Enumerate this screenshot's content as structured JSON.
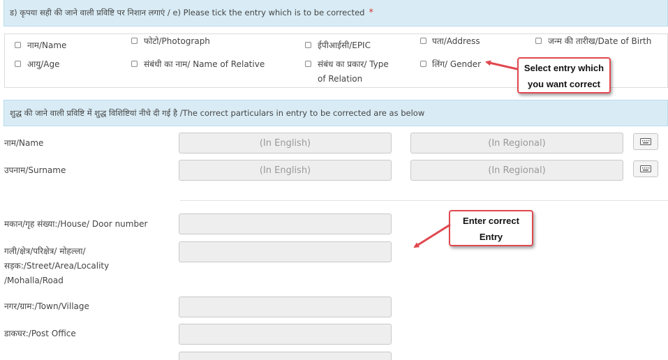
{
  "section_e": {
    "heading": "ड) कृपया सही की जाने वाली प्रविष्टि पर निशान लगाएं / e) Please tick the entry which is to be corrected",
    "required_mark": "*",
    "options": [
      {
        "label": "नाम/Name"
      },
      {
        "label": "फोटो/Photograph"
      },
      {
        "label": "ईपीआईसी/EPIC"
      },
      {
        "label": "पता/Address"
      },
      {
        "label": "जन्म की तारीख/Date of Birth"
      },
      {
        "label": "आयु/Age"
      },
      {
        "label": "संबंधी का नाम/ Name of Relative"
      },
      {
        "label_line1": "संबंध का प्रकार/ Type",
        "label_line2": "of Relation"
      },
      {
        "label": "लिंग/ Gender"
      }
    ]
  },
  "callouts": {
    "select_entry": {
      "line1": "Select entry which",
      "line2": "you want correct"
    },
    "enter_correct": {
      "line1": "Enter correct",
      "line2": "Entry"
    }
  },
  "correct_section": {
    "heading": "शुद्ध की जाने वाली प्रविष्टि में शुद्ध विशिष्टियां नीचे दी गई है /The correct particulars in entry to be corrected are as below",
    "name_label": "नाम/Name",
    "surname_label": "उपनाम/Surname",
    "placeholder_english": "(In English)",
    "placeholder_regional": "(In Regional)",
    "house_label": "मकान/गृह संख्या:/House/ Door number",
    "street_label": [
      "गली/क्षेत्र/परिक्षेत्र/ मोहल्ला/",
      "सड़क:/Street/Area/Locality",
      "/Mohalla/Road"
    ],
    "town_label": "नगर/ग्राम:/Town/Village",
    "post_office_label": "डाकघर:/Post Office"
  },
  "colors": {
    "banner": "#d9ecf5",
    "callout_border": "#e0484e",
    "required": "#d9302b"
  }
}
